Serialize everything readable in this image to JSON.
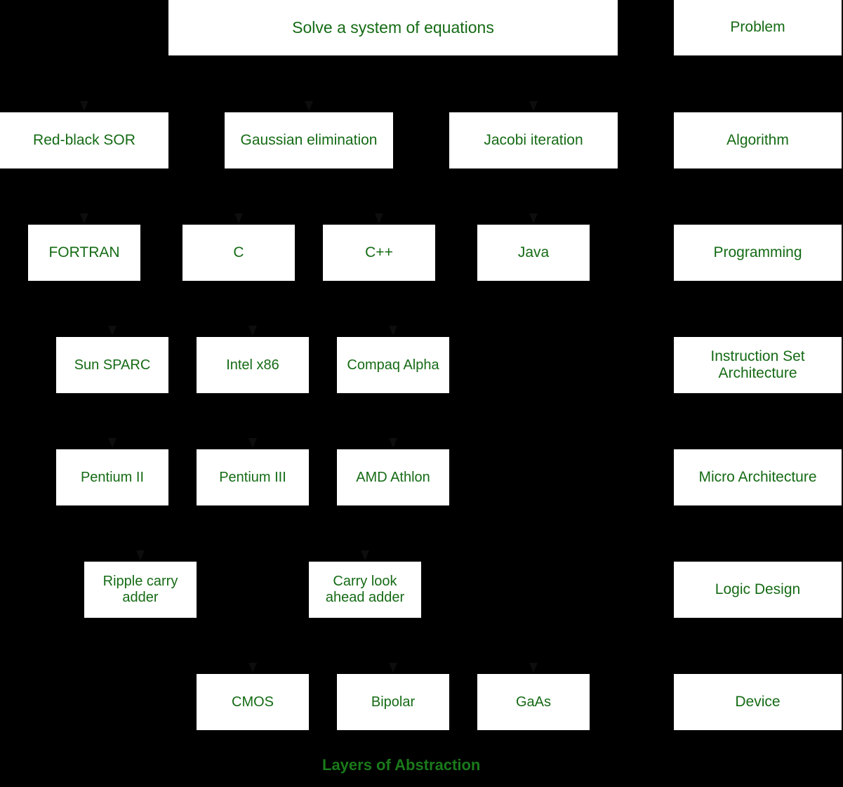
{
  "diagram": {
    "title": "Layers of Abstraction",
    "caption": "Layers of Abstraction",
    "background_color": "#000000",
    "node_fill_color": "#ffffff",
    "node_text_color": "#156b15",
    "caption_color": "#1a7a1a",
    "edge_color": "#000000"
  },
  "levels": [
    {
      "name": "Problem",
      "label": "Problem",
      "items": [
        {
          "label": "Solve a system of equations"
        }
      ]
    },
    {
      "name": "Algorithm",
      "label": "Algorithm",
      "items": [
        {
          "label": "Red-black SOR"
        },
        {
          "label": "Gaussian elimination"
        },
        {
          "label": "Jacobi iteration"
        }
      ]
    },
    {
      "name": "Programming",
      "label": "Programming",
      "items": [
        {
          "label": "FORTRAN"
        },
        {
          "label": "C"
        },
        {
          "label": "C++"
        },
        {
          "label": "Java"
        }
      ]
    },
    {
      "name": "Instruction Set Architecture",
      "label": "Instruction Set Architecture",
      "items": [
        {
          "label": "Sun SPARC"
        },
        {
          "label": "Intel x86"
        },
        {
          "label": "Compaq Alpha"
        }
      ]
    },
    {
      "name": "Micro Architecture",
      "label": "Micro Architecture",
      "items": [
        {
          "label": "Pentium II"
        },
        {
          "label": "Pentium III"
        },
        {
          "label": "AMD Athlon"
        }
      ]
    },
    {
      "name": "Logic Design",
      "label": "Logic Design",
      "items": [
        {
          "label": "Ripple carry adder"
        },
        {
          "label": "Carry look ahead adder"
        }
      ]
    },
    {
      "name": "Device",
      "label": "Device",
      "items": [
        {
          "label": "CMOS"
        },
        {
          "label": "Bipolar"
        },
        {
          "label": "GaAs"
        }
      ]
    }
  ]
}
